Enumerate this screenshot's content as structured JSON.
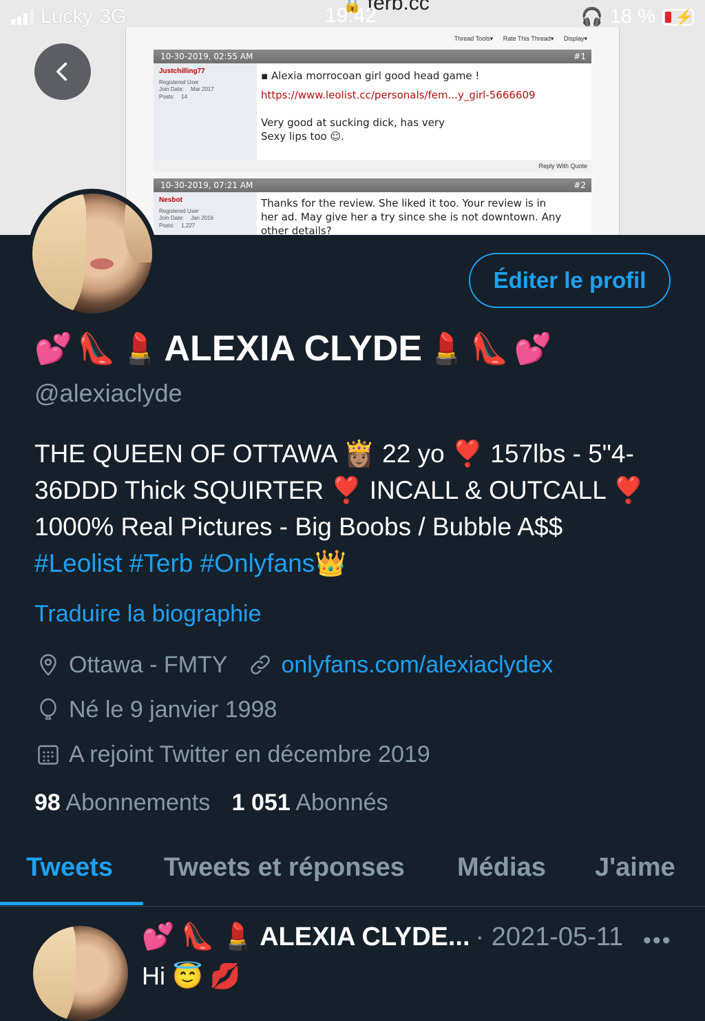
{
  "status_bar": {
    "carrier": "Lucky",
    "network": "3G",
    "time": "19:42",
    "site": "terb.cc",
    "battery": "18 %"
  },
  "banner": {
    "toolbar": [
      "Thread Tools",
      "Rate This Thread",
      "Display"
    ],
    "post1": {
      "date": "10-30-2019, 02:55 AM",
      "num": "#1",
      "user": "Justchilling77",
      "role": "Registered User",
      "join_label": "Join Date:",
      "join": "Mar 2017",
      "posts_label": "Posts:",
      "posts": "14",
      "title": "Alexia morrocoan girl good head game !",
      "link": "https://www.leolist.cc/personals/fem...y_girl-5666609",
      "body1": "Very good at sucking dick, has very",
      "body2": "Sexy lips too",
      "reply": "Reply With Quote"
    },
    "post2": {
      "date": "10-30-2019, 07:21 AM",
      "num": "#2",
      "user": "Nesbot",
      "role": "Registered User",
      "join_label": "Join Date:",
      "join": "Jan 2016",
      "posts_label": "Posts:",
      "posts": "1,227",
      "line1": "Thanks for the review. She liked it too. Your review is in",
      "line2": "her ad. May give her a try since she is not downtown. Any",
      "line3": "other details?"
    }
  },
  "profile": {
    "edit_label": "Éditer le profil",
    "name": "ALEXIA CLYDE",
    "name_emoji_left": [
      "💕",
      "👠",
      "💄"
    ],
    "name_emoji_right": [
      "💄",
      "👠",
      "💕"
    ],
    "handle": "@alexiaclyde",
    "bio_lines": [
      "THE QUEEN OF OTTAWA 👸🏽 22 yo ❣️ 157lbs - 5\"4-",
      "36DDD Thick SQUIRTER ❣️ INCALL & OUTCALL  ❣️",
      "1000% Real Pictures - Big Boobs / Bubble A$$"
    ],
    "hashtags": "#Leolist #Terb #Onlyfans",
    "hashtag_emoji": "👑",
    "translate": "Traduire la biographie",
    "location": "Ottawa - FMTY",
    "website": "onlyfans.com/alexiaclydex",
    "birthday": "Né le 9 janvier 1998",
    "joined": "A rejoint Twitter en décembre 2019",
    "following_count": "98",
    "following_label": "Abonnements",
    "followers_count": "1 051",
    "followers_label": "Abonnés"
  },
  "tabs": [
    "Tweets",
    "Tweets et réponses",
    "Médias",
    "J'aime"
  ],
  "tweet": {
    "emoji": "💕 👠 💄",
    "name": "ALEXIA CLYDE...",
    "date": "· 2021-05-11",
    "more": "•••",
    "text": "Hi 😇 💋"
  },
  "colors": {
    "background": "#15202b",
    "accent": "#1da1f2",
    "muted": "#8899a6"
  },
  "icons": [
    "chevron-left-icon",
    "map-pin-icon",
    "link-icon",
    "balloon-icon",
    "calendar-icon",
    "more-icon"
  ]
}
